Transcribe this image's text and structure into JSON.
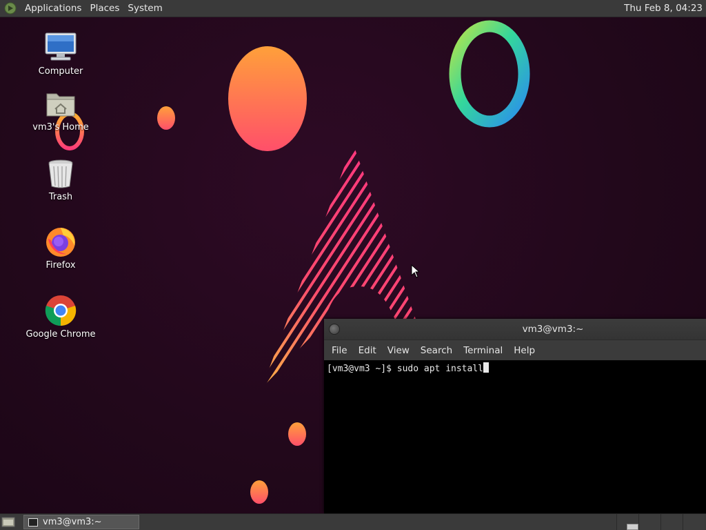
{
  "top_panel": {
    "menus": [
      "Applications",
      "Places",
      "System"
    ],
    "clock": "Thu Feb  8, 04:23"
  },
  "desktop": {
    "icons": [
      {
        "label": "Computer",
        "icon": "computer-icon"
      },
      {
        "label": "vm3's Home",
        "icon": "home-folder-icon"
      },
      {
        "label": "Trash",
        "icon": "trash-icon"
      },
      {
        "label": "Firefox",
        "icon": "firefox-icon"
      },
      {
        "label": "Google Chrome",
        "icon": "chrome-icon"
      }
    ]
  },
  "terminal": {
    "title": "vm3@vm3:~",
    "menu": [
      "File",
      "Edit",
      "View",
      "Search",
      "Terminal",
      "Help"
    ],
    "prompt": "[vm3@vm3 ~]$ ",
    "command": "sudo apt install"
  },
  "bottom_panel": {
    "tasks": [
      {
        "label": "vm3@vm3:~",
        "icon": "terminal-icon"
      }
    ],
    "workspaces": 4,
    "active_workspace": 1
  },
  "colors": {
    "panel": "#3a3a3a",
    "wallpaper": "#23091c",
    "terminal_bg": "#000000"
  }
}
